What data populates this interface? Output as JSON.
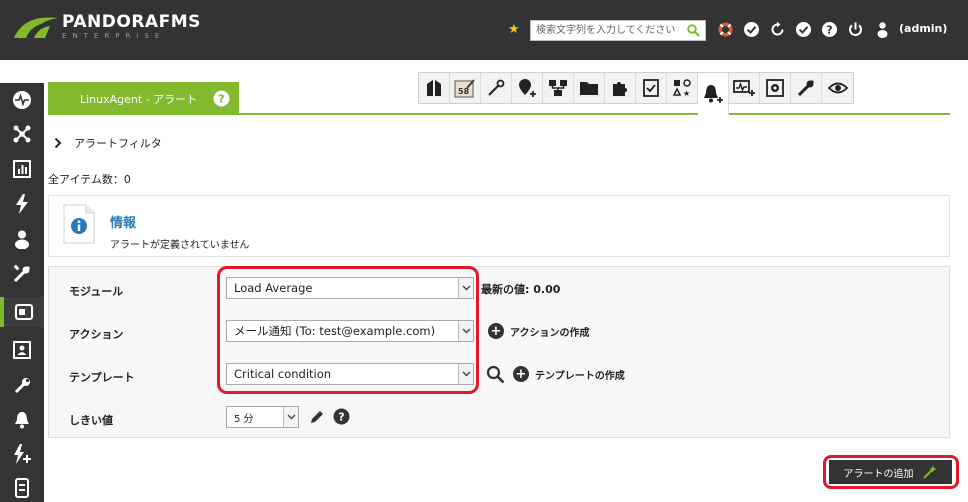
{
  "header": {
    "logo_text": "PANDORAFMS",
    "logo_sub": "ENTERPRISE",
    "search_placeholder": "検索文字列を入力してください",
    "user": "(admin)"
  },
  "tab": {
    "title": "LinuxAgent - アラート"
  },
  "filter": {
    "label": "アラートフィルタ"
  },
  "count_text": "全アイテム数：0",
  "info": {
    "title": "情報",
    "message": "アラートが定義されていません"
  },
  "form": {
    "module_label": "モジュール",
    "module_value": "Load Average",
    "latest_label": "最新の値:",
    "latest_value": "0.00",
    "action_label": "アクション",
    "action_value": "メール通知 (To: test@example.com)",
    "create_action": "アクションの作成",
    "template_label": "テンプレート",
    "template_value": "Critical condition",
    "create_template": "テンプレートの作成",
    "threshold_label": "しきい値",
    "threshold_value": "5 分"
  },
  "add_button": "アラートの追加",
  "colors": {
    "accent": "#82b92e",
    "header_bg": "#333333",
    "highlight_red": "#e01a2a",
    "info_title": "#2a7ab8"
  }
}
